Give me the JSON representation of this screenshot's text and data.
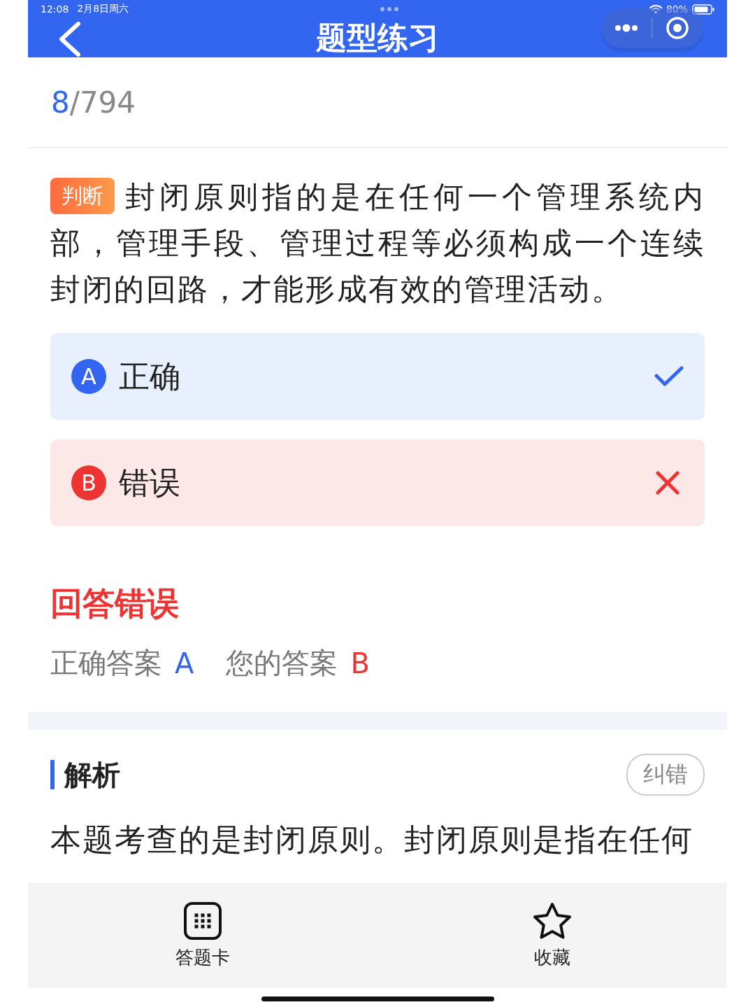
{
  "status_bar": {
    "time": "12:08",
    "date": "2月8日周六",
    "battery": "80%"
  },
  "nav": {
    "title": "题型练习"
  },
  "progress": {
    "current": "8",
    "total": "/794"
  },
  "question": {
    "tag": "判断",
    "text": "封闭原则指的是在任何一个管理系统内部，管理手段、管理过程等必须构成一个连续封闭的回路，才能形成有效的管理活动。"
  },
  "options": [
    {
      "letter": "A",
      "text": "正确",
      "kind": "correct"
    },
    {
      "letter": "B",
      "text": "错误",
      "kind": "wrong"
    }
  ],
  "result": {
    "title": "回答错误",
    "correct_label": "正确答案",
    "correct_value": "A",
    "your_label": "您的答案",
    "your_value": "B"
  },
  "analysis": {
    "title": "解析",
    "report_button": "纠错",
    "text": "本题考查的是封闭原则。封闭原则是指在任何"
  },
  "bottom_bar": [
    {
      "label": "答题卡",
      "kind": "card"
    },
    {
      "label": "收藏",
      "kind": "star"
    }
  ]
}
